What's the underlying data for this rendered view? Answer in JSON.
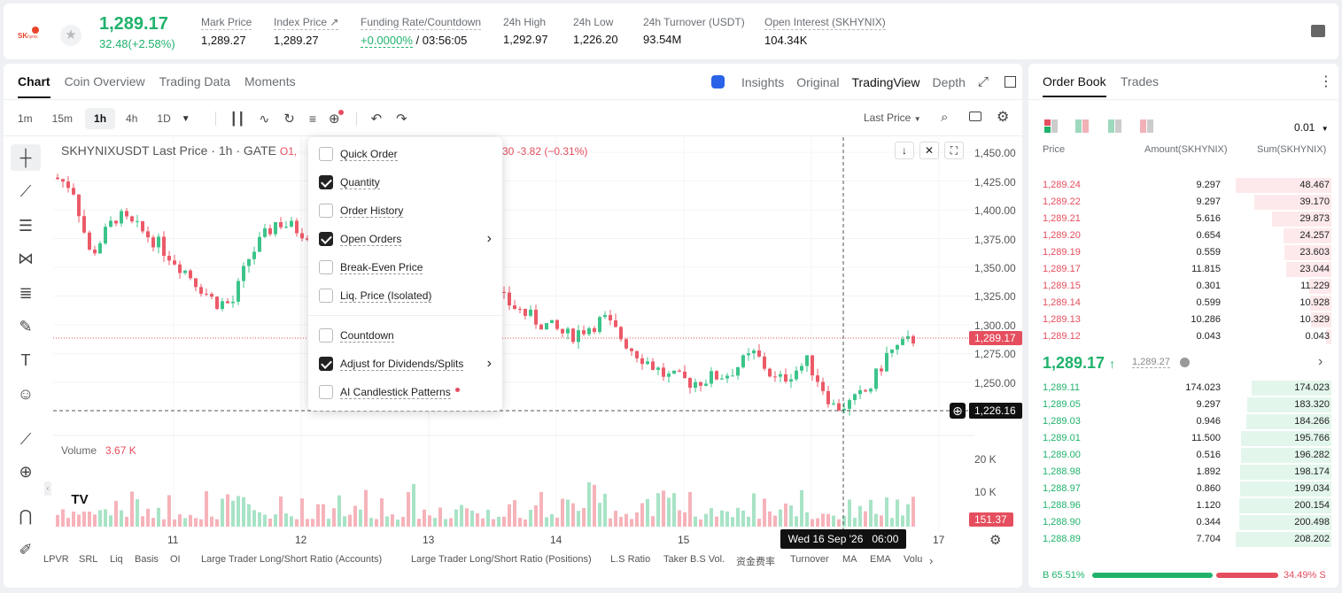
{
  "header": {
    "price": "1,289.17",
    "change": "32.48(+2.58%)",
    "stats": [
      {
        "label": "Mark Price",
        "value": "1,289.27"
      },
      {
        "label": "Index Price ↗",
        "value": "1,289.27"
      },
      {
        "label": "Funding Rate/Countdown",
        "value_green": "+0.0000%",
        "value": " / 03:56:05"
      },
      {
        "label": "24h High",
        "value": "1,292.97"
      },
      {
        "label": "24h Low",
        "value": "1,226.20"
      },
      {
        "label": "24h Turnover (USDT)",
        "value": "93.54M"
      },
      {
        "label": "Open Interest (SKHYNIX)",
        "value": "104.34K"
      }
    ]
  },
  "chart_tabs": [
    "Chart",
    "Coin Overview",
    "Trading Data",
    "Moments"
  ],
  "view_tabs": {
    "insights": "Insights",
    "original": "Original",
    "tradingview": "TradingView",
    "depth": "Depth"
  },
  "intervals": [
    "1m",
    "15m",
    "1h",
    "4h",
    "1D"
  ],
  "price_type": "Last Price",
  "legend": {
    "title": "SKHYNIXUSDT Last Price · 1h · GATE",
    "o": "O1,",
    "change": "30  -3.82 (−0.31%)"
  },
  "volume_label": "Volume",
  "volume_value": "3.67 K",
  "menu_items": [
    {
      "label": "Quick Order",
      "checked": false
    },
    {
      "label": "Quantity",
      "checked": true
    },
    {
      "label": "Order History",
      "checked": false
    },
    {
      "label": "Open Orders",
      "checked": true,
      "arrow": true
    },
    {
      "label": "Break-Even Price",
      "checked": false
    },
    {
      "label": "Liq. Price (Isolated)",
      "checked": false
    },
    {
      "label": "Countdown",
      "checked": false
    },
    {
      "label": "Adjust for Dividends/Splits",
      "checked": true,
      "arrow": true
    },
    {
      "label": "AI Candlestick Patterns",
      "checked": false,
      "dot": true
    }
  ],
  "y_axis": [
    "1,450.00",
    "1,425.00",
    "1,400.00",
    "1,375.00",
    "1,350.00",
    "1,325.00",
    "1,300.00",
    "1,275.00",
    "1,250.00"
  ],
  "price_tag": "1,289.17",
  "low_tag": "1,226.16",
  "vol_axis": [
    "20 K",
    "10 K"
  ],
  "vol_tag": "151.37",
  "x_axis": [
    "11",
    "12",
    "13",
    "14",
    "15",
    "17"
  ],
  "crosshair_date": "Wed 16 Sep '26   06:00",
  "indicators": [
    "LPVR",
    "SRL",
    "Liq",
    "Basis",
    "OI",
    "Large Trader Long/Short Ratio (Accounts)",
    "Large Trader Long/Short Ratio (Positions)",
    "L.S Ratio",
    "Taker B.S Vol.",
    "资金费率",
    "Turnover",
    "MA",
    "EMA",
    "Volu"
  ],
  "orderbook": {
    "tabs": [
      "Order Book",
      "Trades"
    ],
    "precision": "0.01",
    "headers": [
      "Price",
      "Amount(SKHYNIX)",
      "Sum(SKHYNIX)"
    ],
    "asks": [
      [
        "1,289.24",
        "9.297",
        "48.467"
      ],
      [
        "1,289.22",
        "9.297",
        "39.170"
      ],
      [
        "1,289.21",
        "5.616",
        "29.873"
      ],
      [
        "1,289.20",
        "0.654",
        "24.257"
      ],
      [
        "1,289.19",
        "0.559",
        "23.603"
      ],
      [
        "1,289.17",
        "11.815",
        "23.044"
      ],
      [
        "1,289.15",
        "0.301",
        "11.229"
      ],
      [
        "1,289.14",
        "0.599",
        "10.928"
      ],
      [
        "1,289.13",
        "10.286",
        "10.329"
      ],
      [
        "1,289.12",
        "0.043",
        "0.043"
      ]
    ],
    "last_price": "1,289.17",
    "mark_price": "1,289.27",
    "bids": [
      [
        "1,289.11",
        "174.023",
        "174.023"
      ],
      [
        "1,289.05",
        "9.297",
        "183.320"
      ],
      [
        "1,289.03",
        "0.946",
        "184.266"
      ],
      [
        "1,289.01",
        "11.500",
        "195.766"
      ],
      [
        "1,289.00",
        "0.516",
        "196.282"
      ],
      [
        "1,288.98",
        "1.892",
        "198.174"
      ],
      [
        "1,288.97",
        "0.860",
        "199.034"
      ],
      [
        "1,288.96",
        "1.120",
        "200.154"
      ],
      [
        "1,288.90",
        "0.344",
        "200.498"
      ],
      [
        "1,288.89",
        "7.704",
        "208.202"
      ]
    ],
    "buy_ratio": "B 65.51%",
    "sell_ratio": "34.49% S",
    "buy_fraction": 0.6551
  }
}
